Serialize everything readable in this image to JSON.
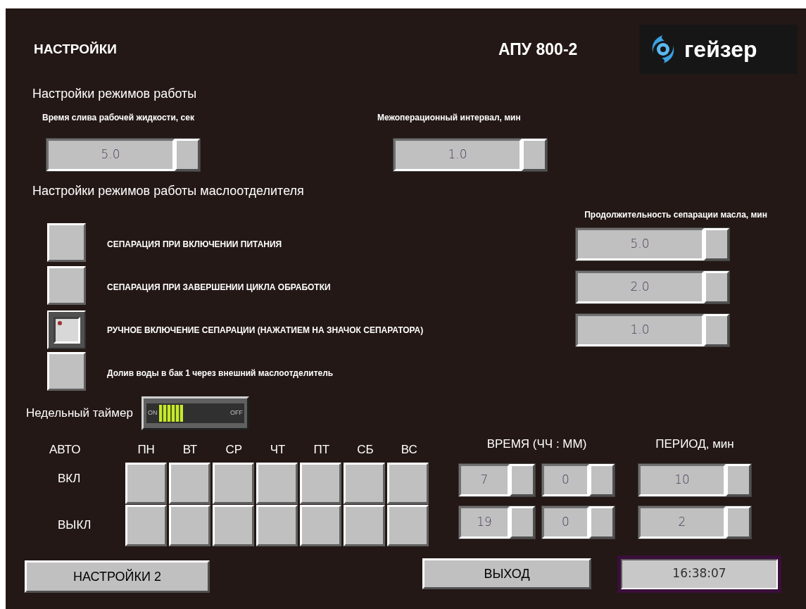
{
  "title": "НАСТРОЙКИ",
  "model": "АПУ 800-2",
  "logo": {
    "text": "гейзер"
  },
  "modes": {
    "heading": "Настройки режимов работы",
    "fields": [
      {
        "label": "Время слива рабочей жидкости, сек",
        "value": "5.0"
      },
      {
        "label": "Межоперационный интервал, мин",
        "value": "1.0"
      }
    ]
  },
  "separator": {
    "heading": "Настройки режимов работы маслоотделителя",
    "duration_label": "Продолжительность сепарации масла, мин",
    "options": [
      {
        "label": "СЕПАРАЦИЯ ПРИ ВКЛЮЧЕНИИ ПИТАНИЯ",
        "checked": false,
        "value": "5.0"
      },
      {
        "label": "СЕПАРАЦИЯ ПРИ ЗАВЕРШЕНИИ ЦИКЛА ОБРАБОТКИ",
        "checked": false,
        "value": "2.0"
      },
      {
        "label": "РУЧНОЕ ВКЛЮЧЕНИЕ СЕПАРАЦИИ (НАЖАТИЕМ НА ЗНАЧОК СЕПАРАТОРА)",
        "checked": true,
        "value": "1.0"
      },
      {
        "label": "Долив воды в бак 1 через внешний маслоотделитель",
        "checked": false
      }
    ]
  },
  "weekly_timer": {
    "label": "Недельный таймер",
    "switch": {
      "on": true,
      "on_text": "ON",
      "off_text": "OFF"
    },
    "auto_label": "АВТО",
    "days": [
      "ПН",
      "ВТ",
      "СР",
      "ЧТ",
      "ПТ",
      "СБ",
      "ВС"
    ],
    "time_heading": "ВРЕМЯ (ЧЧ : ММ)",
    "period_heading": "ПЕРИОД, мин",
    "rows": [
      {
        "label": "ВКЛ",
        "days": [
          false,
          false,
          false,
          false,
          false,
          false,
          false
        ],
        "hours": "7",
        "minutes": "0",
        "period": "10"
      },
      {
        "label": "ВЫКЛ",
        "days": [
          false,
          false,
          false,
          false,
          false,
          false,
          false
        ],
        "hours": "19",
        "minutes": "0",
        "period": "2"
      }
    ]
  },
  "buttons": [
    {
      "label": "НАСТРОЙКИ 2"
    },
    {
      "label": "ВЫХОД"
    }
  ],
  "clock": "16:38:07"
}
